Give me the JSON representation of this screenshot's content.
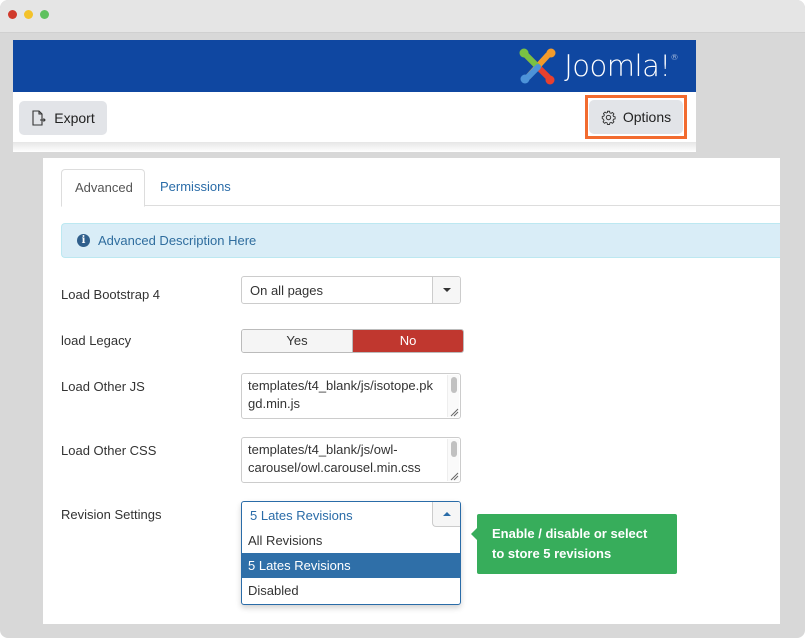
{
  "window": {
    "controls": [
      "close",
      "minimize",
      "maximize"
    ]
  },
  "header": {
    "logo_text": "Joomla!",
    "logo_mark": "®",
    "logo_icon": "joomla-logo-icon"
  },
  "toolbar": {
    "export_label": "Export",
    "export_icon": "export-icon",
    "options_label": "Options",
    "options_icon": "gear-icon",
    "highlight_color": "#f26b2f"
  },
  "tabs": [
    {
      "label": "Advanced",
      "active": true
    },
    {
      "label": "Permissions",
      "active": false
    }
  ],
  "alert": {
    "icon": "info-icon",
    "text": "Advanced Description Here"
  },
  "fields": {
    "load_bootstrap": {
      "label": "Load Bootstrap 4",
      "value": "On all pages"
    },
    "load_legacy": {
      "label": "load Legacy",
      "options": [
        "Yes",
        "No"
      ],
      "selected": "No"
    },
    "load_other_js": {
      "label": "Load Other JS",
      "value_line1": "templates/t4_blank/js/isotope.pk",
      "value_line2": "gd.min.js"
    },
    "load_other_css": {
      "label": "Load Other CSS",
      "value_line1": "templates/t4_blank/js/owl-",
      "value_line2": "carousel/owl.carousel.min.css"
    },
    "revision_settings": {
      "label": "Revision Settings",
      "value": "5 Lates Revisions",
      "options": [
        "All Revisions",
        "5 Lates Revisions",
        "Disabled"
      ],
      "selected_index": 1,
      "open": true
    }
  },
  "tooltip": {
    "line1": "Enable / disable or select",
    "line2": "to store 5 revisions",
    "color": "#37ad5b"
  }
}
